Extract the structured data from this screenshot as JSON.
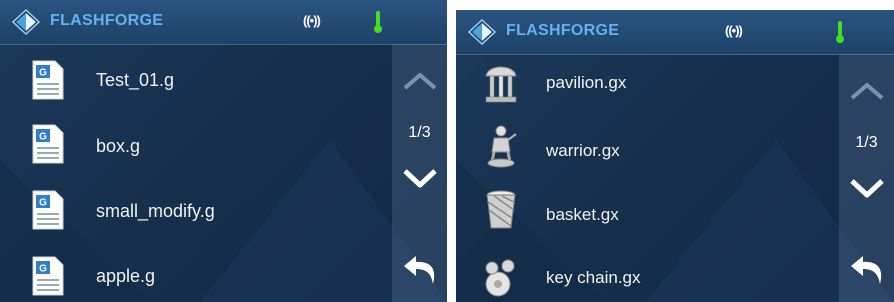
{
  "left_screen": {
    "brand": "FLASHFORGE",
    "wifi_symbol": "((•))",
    "page_indicator": "1/3",
    "files": [
      {
        "name": "Test_01.g",
        "icon": "gcode-file-icon",
        "badge": "G"
      },
      {
        "name": "box.g",
        "icon": "gcode-file-icon",
        "badge": "G"
      },
      {
        "name": "small_modify.g",
        "icon": "gcode-file-icon",
        "badge": "G"
      },
      {
        "name": "apple.g",
        "icon": "gcode-file-icon",
        "badge": "G"
      }
    ]
  },
  "right_screen": {
    "brand": "FLASHFORGE",
    "wifi_symbol": "((•))",
    "page_indicator": "1/3",
    "files": [
      {
        "name": "pavilion.gx",
        "icon": "pavilion-model-icon"
      },
      {
        "name": "warrior.gx",
        "icon": "warrior-model-icon"
      },
      {
        "name": "basket.gx",
        "icon": "basket-model-icon"
      },
      {
        "name": "key chain.gx",
        "icon": "key-chain-model-icon"
      }
    ]
  },
  "colors": {
    "background": "#16304e",
    "header": "#24507a",
    "brand_text": "#5fb3ef",
    "thermometer": "#44dd22",
    "sidebar": "#4c6a8a"
  }
}
